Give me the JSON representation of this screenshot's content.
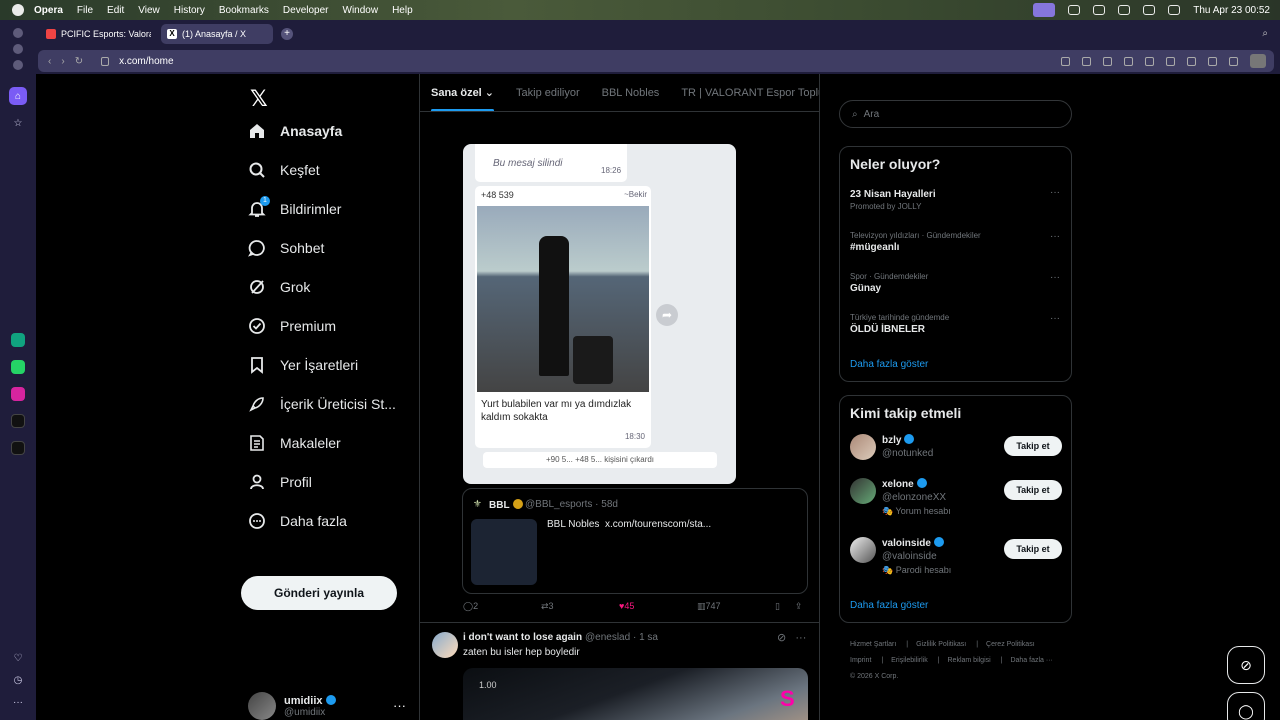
{
  "menubar": {
    "app": "Opera",
    "items": [
      "File",
      "Edit",
      "View",
      "History",
      "Bookmarks",
      "Developer",
      "Window",
      "Help"
    ],
    "clock": "Thu Apr 23  00:52"
  },
  "tabs": [
    {
      "title": "PCIFIC Esports: Valorant",
      "active": false
    },
    {
      "title": "(1) Anasayfa / X",
      "active": true
    }
  ],
  "address": {
    "url": "x.com/home"
  },
  "nav": {
    "items": [
      {
        "label": "Anasayfa",
        "icon": "home-icon"
      },
      {
        "label": "Keşfet",
        "icon": "search-icon"
      },
      {
        "label": "Bildirimler",
        "icon": "bell-icon",
        "badge": "1"
      },
      {
        "label": "Sohbet",
        "icon": "chat-icon"
      },
      {
        "label": "Grok",
        "icon": "grok-icon"
      },
      {
        "label": "Premium",
        "icon": "premium-icon"
      },
      {
        "label": "Yer İşaretleri",
        "icon": "bookmark-icon"
      },
      {
        "label": "İçerik Üreticisi St...",
        "icon": "rocket-icon"
      },
      {
        "label": "Makaleler",
        "icon": "article-icon"
      },
      {
        "label": "Profil",
        "icon": "person-icon"
      },
      {
        "label": "Daha fazla",
        "icon": "more-circle-icon"
      }
    ],
    "post_button": "Gönderi yayınla",
    "account": {
      "name": "umidiix",
      "handle": "@umidiix"
    }
  },
  "feed": {
    "tabs": [
      "Sana özel",
      "Takip ediliyor",
      "BBL Nobles",
      "TR | VALORANT Espor Topluluğu"
    ],
    "image1": {
      "deleted": "Bu mesaj silindi",
      "time1": "18:26",
      "num": "+48 539",
      "sender": "~Bekir",
      "message": "Yurt bulabilen var mı ya dımdızlak kaldım sokakta",
      "time2": "18:30",
      "info": "+90 5... +48 5... kişisini çıkardı"
    },
    "quote": {
      "name": "BBL",
      "handle": "@BBL_esports · 58d",
      "text": "BBL Nobles  x.com/tourenscom/sta..."
    },
    "actions": {
      "replies": "2",
      "reposts": "3",
      "likes": "45",
      "views": "747"
    },
    "post2": {
      "name": "i don't want to lose again",
      "meta": "@eneslad · 1 sa",
      "text": "zaten bu isler hep boyledir",
      "image_label": "1.00"
    }
  },
  "right": {
    "search_placeholder": "Ara",
    "trends_title": "Neler oluyor?",
    "trends": [
      {
        "context": "",
        "title": "23 Nisan Hayalleri",
        "sub": "Promoted by JOLLY"
      },
      {
        "context": "Televizyon yıldızları · Gündemdekiler",
        "title": "#mügeanlı",
        "sub": ""
      },
      {
        "context": "Spor · Gündemdekiler",
        "title": "Günay",
        "sub": ""
      },
      {
        "context": "Türkiye tarihinde gündemde",
        "title": "ÖLDÜ İBNELER",
        "sub": ""
      }
    ],
    "show_more": "Daha fazla göster",
    "wtf_title": "Kimi takip etmeli",
    "who_to_follow": [
      {
        "name": "bzly",
        "handle": "@notunked",
        "label": "",
        "button": "Takip et"
      },
      {
        "name": "xelone",
        "handle": "@elonzoneXX",
        "label": "Yorum hesabı",
        "button": "Takip et"
      },
      {
        "name": "valoinside",
        "handle": "@valoinside",
        "label": "Parodi hesabı",
        "button": "Takip et"
      }
    ],
    "footer": [
      "Hizmet Şartları",
      "Gizlilik Politikası",
      "Çerez Politikası",
      "Imprint",
      "Erişilebilirlik",
      "Reklam bilgisi",
      "Daha fazla ···",
      "© 2026 X Corp."
    ]
  }
}
